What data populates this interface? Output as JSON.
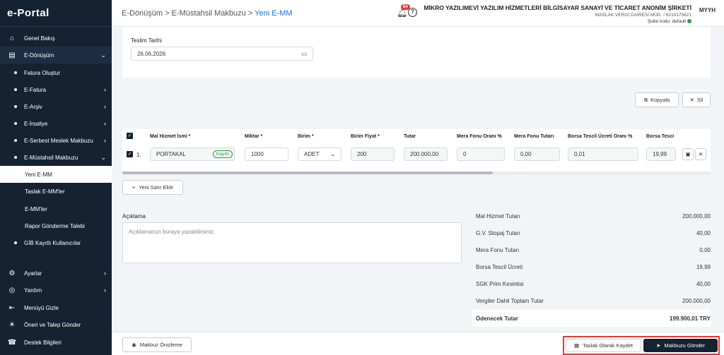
{
  "app": {
    "logo": "e-Portal"
  },
  "sidebar": {
    "items": [
      {
        "label": "Genel Bakış",
        "icon": "home-icon"
      },
      {
        "label": "E-Dönüşüm",
        "icon": "document-icon"
      },
      {
        "label": "Fatura Oluştur"
      },
      {
        "label": "E-Fatura"
      },
      {
        "label": "E-Arşiv"
      },
      {
        "label": "E-İrsaliye"
      },
      {
        "label": "E-Serbest Meslek Makbuzu"
      },
      {
        "label": "E-Müstahsil Makbuzu"
      },
      {
        "label": "Yeni E-MM"
      },
      {
        "label": "Taslak E-MM'ler"
      },
      {
        "label": "E-MM'ler"
      },
      {
        "label": "Rapor Gönderme Talebi"
      },
      {
        "label": "GİB Kayıtlı Kullanıcılar"
      },
      {
        "label": "Ayarlar",
        "icon": "gear-icon"
      },
      {
        "label": "Yardım",
        "icon": "lifebuoy-icon"
      },
      {
        "label": "Menüyü Gizle",
        "icon": "collapse-icon"
      },
      {
        "label": "Öneri ve Talep Gönder",
        "icon": "lightbulb-icon"
      },
      {
        "label": "Destek Bilgileri",
        "icon": "support-icon"
      }
    ]
  },
  "header": {
    "breadcrumb": [
      "E-Dönüşüm",
      "E-Müstahsil Makbuzu",
      "Yeni E-MM"
    ],
    "notifications": "64",
    "company_name": "MİKRO YAZILIMEVİ YAZILIM HİZMETLERİ BİLGİSAYAR SANAYİ VE TİCARET ANONİM ŞİRKETİ",
    "tax_info": "MASLAK VERGİ DAİRESİ MÜD. / 6210175621",
    "branch_label": "Şube kodu: default",
    "avatar": "MYYH"
  },
  "form": {
    "delivery_date_label": "Teslim Tarihi",
    "delivery_date_value": "26.06.2026"
  },
  "actions": {
    "copy": "Kopyala",
    "delete": "Sil"
  },
  "table": {
    "headers": [
      "Mal Hizmet İsmi *",
      "Miktar *",
      "Birim *",
      "Birim Fiyat *",
      "Tutar",
      "Mera Fonu Oranı %",
      "Mera Fonu Tutarı",
      "Borsa Tescil Ücreti Oranı %",
      "Borsa Tesci"
    ],
    "row": {
      "index": "1.",
      "name": "PORTAKAL",
      "badge": "Kayıtlı",
      "quantity": "1000",
      "unit": "ADET",
      "unit_price": "200",
      "amount": "200.000,00",
      "mera_rate": "0",
      "mera_amount": "0,00",
      "borsa_rate": "0,01",
      "borsa_amount": "19,99"
    },
    "add_row": "Yeni Satır Ekle"
  },
  "notes": {
    "label": "Açıklama",
    "placeholder": "Açıklamanızı buraya yazabilirsiniz."
  },
  "summary": [
    {
      "label": "Mal Hizmet Tutarı",
      "value": "200.000,00"
    },
    {
      "label": "G.V. Stopaj Tutarı",
      "value": "40,00"
    },
    {
      "label": "Mera Fonu Tutarı",
      "value": "0,00"
    },
    {
      "label": "Borsa Tescil Ücreti",
      "value": "19,99"
    },
    {
      "label": "SGK Prim Kesintisi",
      "value": "40,00"
    },
    {
      "label": "Vergiler Dahil Toplam Tutar",
      "value": "200.000,00"
    },
    {
      "label": "Ödenecek Tutar",
      "value": "199.900,01 TRY"
    }
  ],
  "footer": {
    "preview": "Makbuz Önizleme",
    "save_draft": "Taslak Olarak Kaydet",
    "send": "Makbuzu Gönder"
  },
  "colors": {
    "sidebar": "#152232",
    "accent": "#1a73e8",
    "highlight": "#e53935",
    "success": "#2e9b45"
  }
}
